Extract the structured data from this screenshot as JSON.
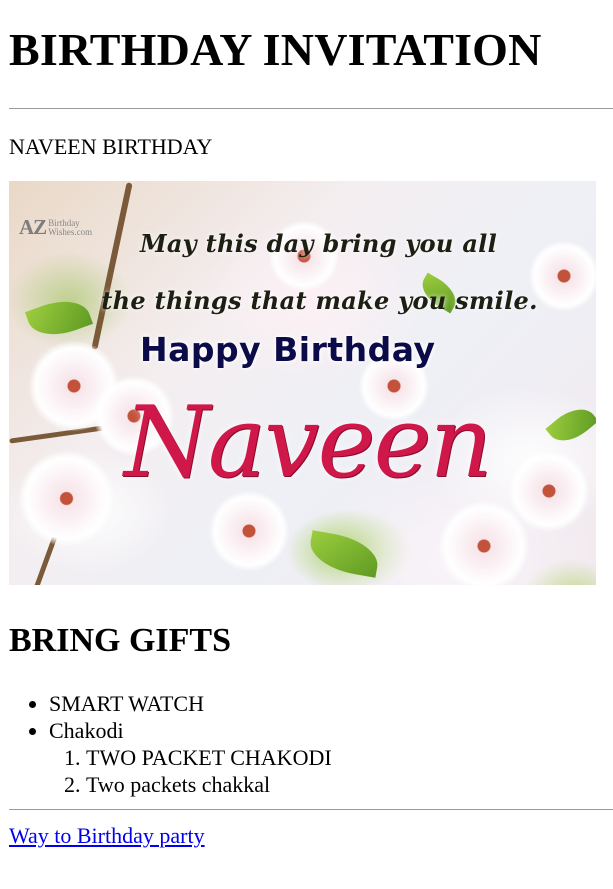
{
  "page": {
    "title": "BIRTHDAY INVITATION",
    "subtitle": "NAVEEN BIRTHDAY"
  },
  "card": {
    "logo_mark": "AZ",
    "logo_line1": "Birthday",
    "logo_line2": "Wishes.com",
    "message_line1": "May this day bring you all",
    "message_line2": "the things that make you smile.",
    "greeting": "Happy Birthday",
    "name": "Naveen",
    "colors": {
      "name": "#d0174a",
      "greeting": "#0b0b4a"
    }
  },
  "gifts": {
    "heading": "BRING GIFTS",
    "items": [
      {
        "label": "SMART WATCH"
      },
      {
        "label": "Chakodi"
      }
    ],
    "sub_items": [
      {
        "label": "TWO PACKET CHAKODI"
      },
      {
        "label": "Two packets chakkal"
      }
    ]
  },
  "footer": {
    "link_text": "Way to Birthday party",
    "link_color": "#0000ee"
  }
}
